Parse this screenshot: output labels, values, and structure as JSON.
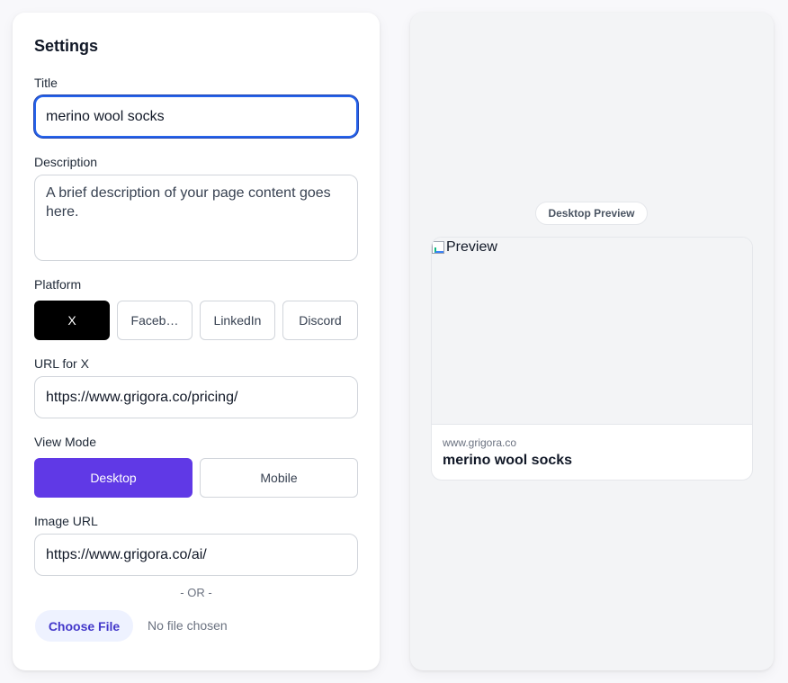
{
  "settings": {
    "heading": "Settings",
    "title_label": "Title",
    "title_value": "merino wool socks",
    "description_label": "Description",
    "description_value": "A brief description of your page content goes here.",
    "platform_label": "Platform",
    "platforms": [
      "X",
      "Faceb…",
      "LinkedIn",
      "Discord"
    ],
    "selected_platform": "X",
    "url_label": "URL for X",
    "url_value": "https://www.grigora.co/pricing/",
    "view_mode_label": "View Mode",
    "view_modes": [
      "Desktop",
      "Mobile"
    ],
    "selected_view_mode": "Desktop",
    "image_url_label": "Image URL",
    "image_url_value": "https://www.grigora.co/ai/",
    "or_text": "- OR -",
    "choose_file_label": "Choose File",
    "file_status": "No file chosen"
  },
  "preview": {
    "badge": "Desktop Preview",
    "image_alt": "Preview",
    "domain": "www.grigora.co",
    "title": "merino wool socks"
  },
  "colors": {
    "accent_purple": "#6039e6",
    "focus_blue": "#2563eb",
    "platform_active": "#000000",
    "file_button_bg": "#eef2ff",
    "file_button_text": "#4338ca"
  }
}
